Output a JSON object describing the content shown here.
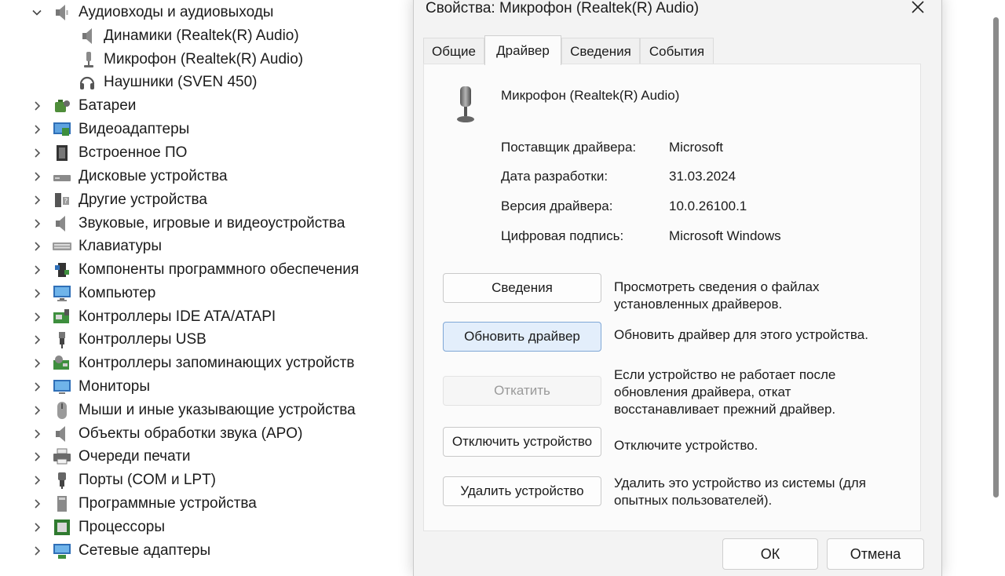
{
  "tree": {
    "expanded": {
      "label": "Аудиовходы и аудиовыходы",
      "icon": "speaker-icon",
      "children": [
        {
          "label": "Динамики (Realtek(R) Audio)",
          "icon": "speaker-icon"
        },
        {
          "label": "Микрофон (Realtek(R) Audio)",
          "icon": "microphone-icon"
        },
        {
          "label": "Наушники (SVEN 450)",
          "icon": "headphones-icon"
        }
      ]
    },
    "categories": [
      {
        "label": "Батареи",
        "icon": "battery-icon"
      },
      {
        "label": "Видеоадаптеры",
        "icon": "display-adapter-icon"
      },
      {
        "label": "Встроенное ПО",
        "icon": "firmware-icon"
      },
      {
        "label": "Дисковые устройства",
        "icon": "disk-drive-icon"
      },
      {
        "label": "Другие устройства",
        "icon": "unknown-device-icon"
      },
      {
        "label": "Звуковые, игровые и видеоустройства",
        "icon": "speaker-icon"
      },
      {
        "label": "Клавиатуры",
        "icon": "keyboard-icon"
      },
      {
        "label": "Компоненты программного обеспечения",
        "icon": "software-component-icon"
      },
      {
        "label": "Компьютер",
        "icon": "computer-icon"
      },
      {
        "label": "Контроллеры IDE ATA/ATAPI",
        "icon": "ide-controller-icon"
      },
      {
        "label": "Контроллеры USB",
        "icon": "usb-icon"
      },
      {
        "label": "Контроллеры запоминающих устройств",
        "icon": "storage-controller-icon"
      },
      {
        "label": "Мониторы",
        "icon": "monitor-icon"
      },
      {
        "label": "Мыши и иные указывающие устройства",
        "icon": "mouse-icon"
      },
      {
        "label": "Объекты обработки звука (APO)",
        "icon": "speaker-icon"
      },
      {
        "label": "Очереди печати",
        "icon": "printer-icon"
      },
      {
        "label": "Порты (COM и LPT)",
        "icon": "port-icon"
      },
      {
        "label": "Программные устройства",
        "icon": "software-device-icon"
      },
      {
        "label": "Процессоры",
        "icon": "processor-icon"
      },
      {
        "label": "Сетевые адаптеры",
        "icon": "network-adapter-icon"
      }
    ]
  },
  "dialog": {
    "title": "Свойства: Микрофон (Realtek(R) Audio)",
    "tabs": [
      {
        "label": "Общие",
        "active": false
      },
      {
        "label": "Драйвер",
        "active": true
      },
      {
        "label": "Сведения",
        "active": false
      },
      {
        "label": "События",
        "active": false
      }
    ],
    "device_name": "Микрофон (Realtek(R) Audio)",
    "info": [
      {
        "label": "Поставщик драйвера:",
        "value": "Microsoft"
      },
      {
        "label": "Дата разработки:",
        "value": "31.03.2024"
      },
      {
        "label": "Версия драйвера:",
        "value": "10.0.26100.1"
      },
      {
        "label": "Цифровая подпись:",
        "value": "Microsoft Windows"
      }
    ],
    "actions": [
      {
        "button": "Сведения",
        "description": "Просмотреть сведения о файлах установленных драйверов.",
        "state": "normal"
      },
      {
        "button": "Обновить драйвер",
        "description": "Обновить драйвер для этого устройства.",
        "state": "primary"
      },
      {
        "button": "Откатить",
        "description": "Если устройство не работает после обновления драйвера, откат восстанавливает прежний драйвер.",
        "state": "disabled"
      },
      {
        "button": "Отключить устройство",
        "description": "Отключите устройство.",
        "state": "normal"
      },
      {
        "button": "Удалить устройство",
        "description": "Удалить это устройство из системы (для опытных пользователей).",
        "state": "normal"
      }
    ],
    "ok_label": "ОК",
    "cancel_label": "Отмена"
  },
  "colors": {
    "accent": "#7fa7d6",
    "primary_button_bg": "#e3eefb",
    "dialog_bg": "#f3f3f3"
  }
}
